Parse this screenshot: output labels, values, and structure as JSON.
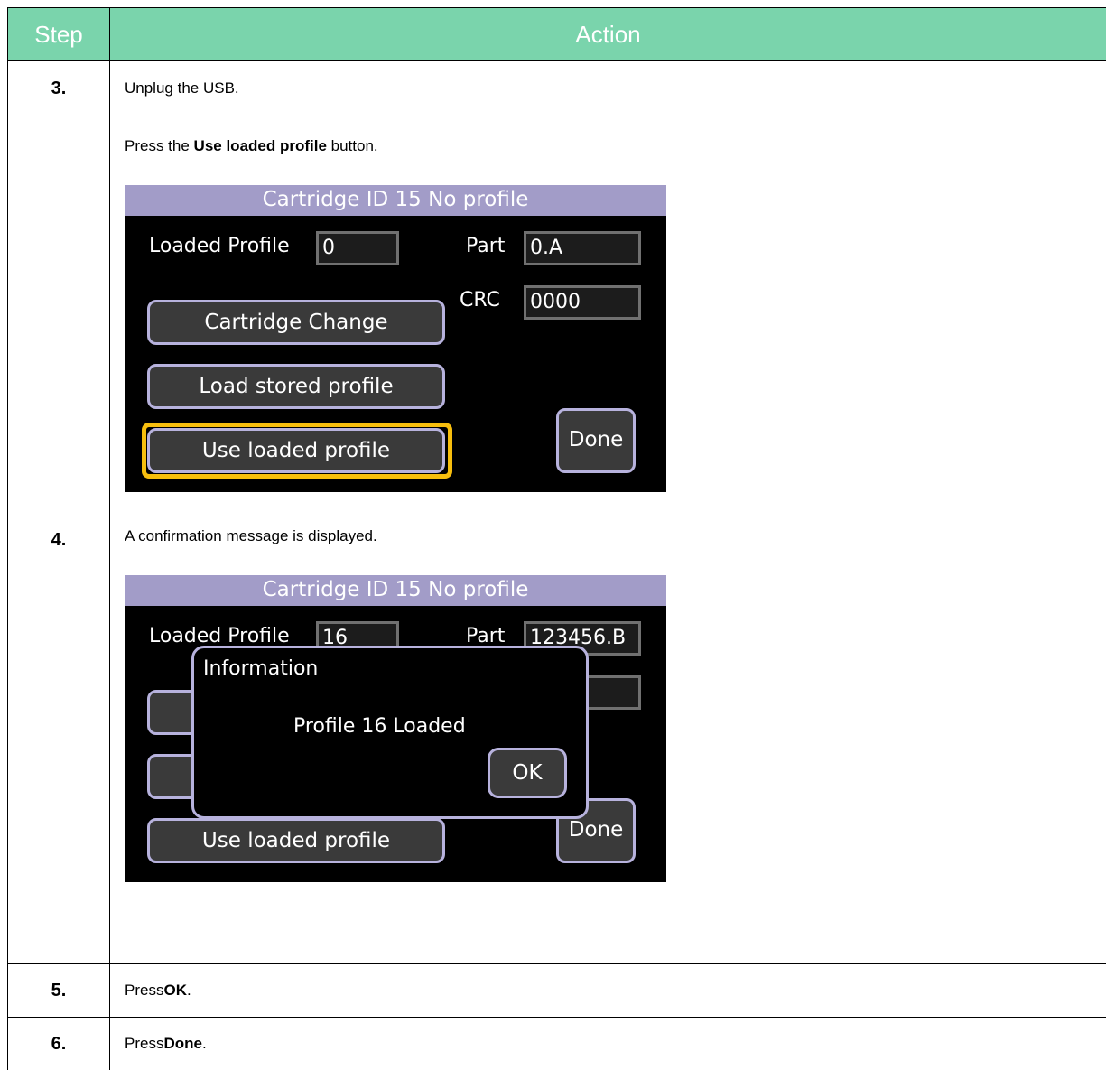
{
  "header": {
    "step": "Step",
    "action": "Action"
  },
  "rows": {
    "r3": {
      "step": "3.",
      "text": "Unplug the USB."
    },
    "r4": {
      "step": "4.",
      "intro_prefix": "Press the ",
      "intro_bold": "Use loaded profile",
      "intro_suffix": " button.",
      "middle": "A confirmation message is displayed."
    },
    "r5": {
      "step": "5.",
      "prefix": "Press ",
      "bold": "OK",
      "suffix": "."
    },
    "r6": {
      "step": "6.",
      "prefix": "Press ",
      "bold": "Done",
      "suffix": "."
    }
  },
  "screen1": {
    "title": "Cartridge ID 15 No profile",
    "loaded_profile_label": "Loaded Profile",
    "loaded_profile_value": "0",
    "part_label": "Part",
    "part_value": "0.A",
    "crc_label": "CRC",
    "crc_value": "0000",
    "btn_cartridge_change": "Cartridge Change",
    "btn_load_stored": "Load stored profile",
    "btn_use_loaded": "Use loaded profile",
    "btn_done": "Done",
    "highlight_color": "#f7be0e"
  },
  "screen2": {
    "title": "Cartridge ID 15 No profile",
    "loaded_profile_label": "Loaded Profile",
    "loaded_profile_value": "16",
    "part_label": "Part",
    "part_value": "123456.B",
    "btn_use_loaded": "Use loaded profile",
    "btn_done": "Done",
    "dialog_title": "Information",
    "dialog_message": "Profile 16 Loaded",
    "dialog_ok": "OK"
  },
  "colors": {
    "header_bg": "#7ad4ac",
    "screen_title_bg": "#a29cc8",
    "button_border": "#b7b2dd"
  }
}
